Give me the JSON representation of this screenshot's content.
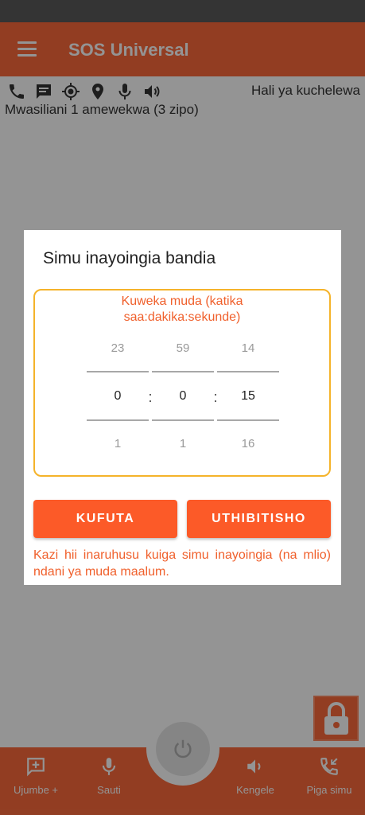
{
  "app": {
    "title": "SOS Universal"
  },
  "status_icons": [
    "phone-icon",
    "message-icon",
    "location-target-icon",
    "location-pin-icon",
    "microphone-icon",
    "speaker-icon"
  ],
  "delay_label": "Hali ya kuchelewa",
  "contacts_text": "Mwasiliani 1 amewekwa (3 zipo)",
  "dialog": {
    "title": "Simu inayoingia bandia",
    "time_box_title_line1": "Kuweka muda (katika",
    "time_box_title_line2": "saa:dakika:sekunde)",
    "picker": {
      "hours": {
        "prev": "23",
        "value": "0",
        "next": "1"
      },
      "minutes": {
        "prev": "59",
        "value": "0",
        "next": "1"
      },
      "seconds": {
        "prev": "14",
        "value": "15",
        "next": "16"
      },
      "separator": ":"
    },
    "cancel_label": "KUFUTA",
    "confirm_label": "UTHIBITISHO",
    "description": "Kazi hii inaruhusu kuiga simu inayoingia (na mlio) ndani ya muda maalum."
  },
  "bottom_nav": {
    "message": "Ujumbe +",
    "voice": "Sauti",
    "bell": "Kengele",
    "call": "Piga simu"
  },
  "colors": {
    "accent": "#fc6a3c",
    "button": "#fc5a28",
    "box_border": "#f5b32a",
    "text_accent": "#f0602c"
  }
}
